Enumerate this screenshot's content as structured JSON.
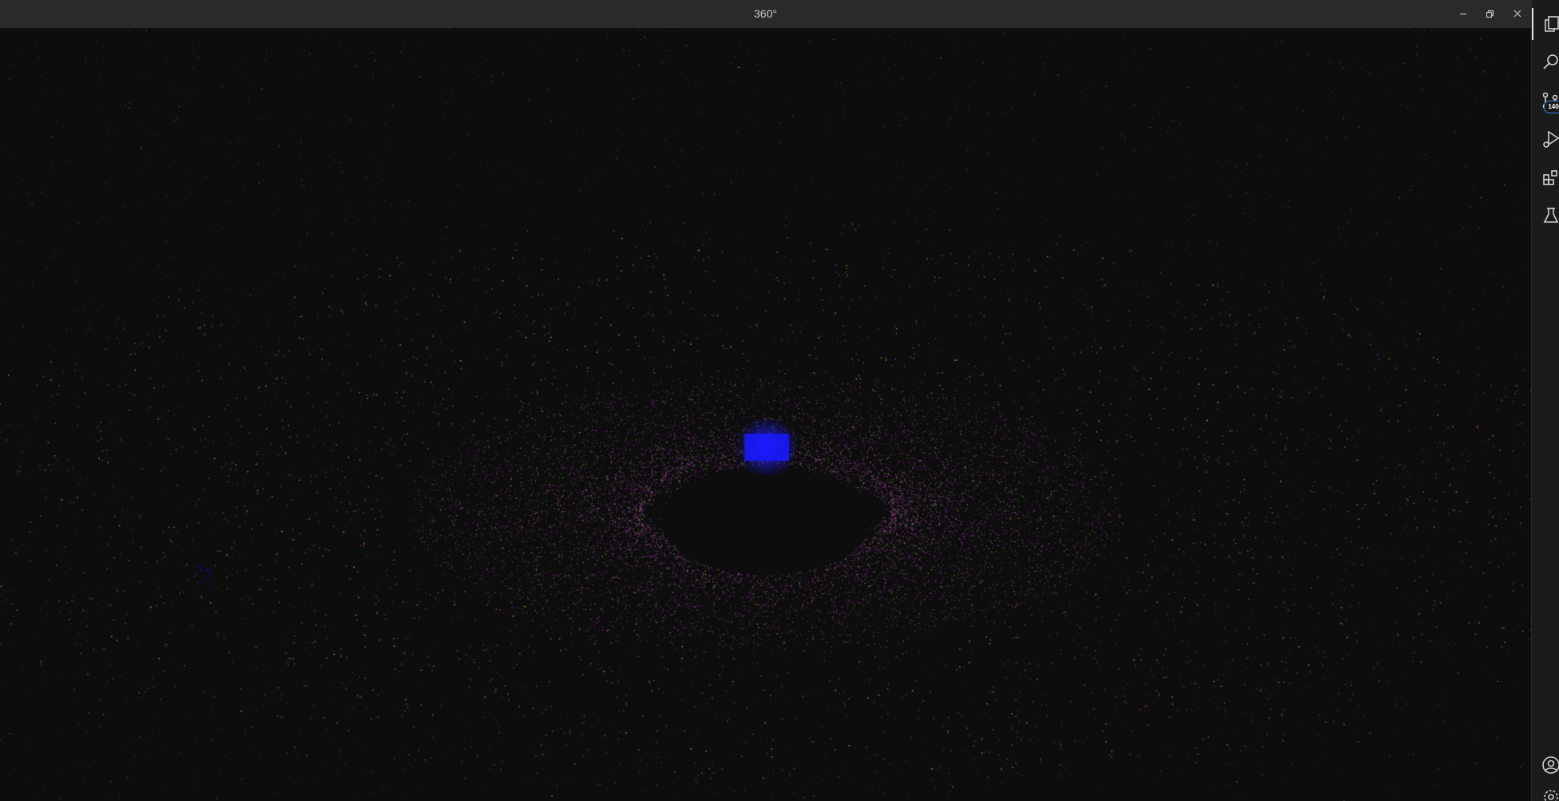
{
  "window": {
    "title": "360°"
  },
  "viewport": {
    "background": "#0d0d0e",
    "particle_colors": [
      "#c43ec7",
      "#9ad14a",
      "#6b6b6b",
      "#1c1cff"
    ],
    "center_cube_color": "#1a1aff"
  },
  "activity_bar": {
    "items": [
      {
        "name": "explorer",
        "icon": "files-icon"
      },
      {
        "name": "search",
        "icon": "search-icon"
      },
      {
        "name": "source-control",
        "icon": "source-control-icon",
        "badge": "140"
      },
      {
        "name": "run-and-debug",
        "icon": "run-debug-icon"
      },
      {
        "name": "extensions",
        "icon": "extensions-icon"
      },
      {
        "name": "testing",
        "icon": "beaker-icon"
      }
    ],
    "bottom_items": [
      {
        "name": "accounts",
        "icon": "account-icon"
      },
      {
        "name": "manage",
        "icon": "gear-icon"
      }
    ]
  }
}
